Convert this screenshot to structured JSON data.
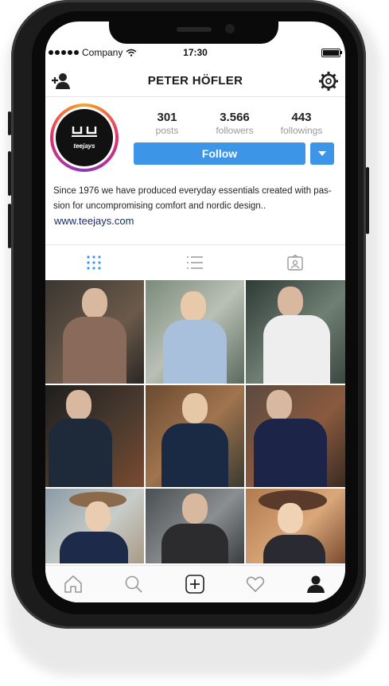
{
  "status_bar": {
    "carrier": "Company",
    "time": "17:30"
  },
  "profile": {
    "name": "PETER HÖFLER",
    "logo_text": "teejays",
    "stats": [
      {
        "value": "301",
        "label": "posts"
      },
      {
        "value": "3.566",
        "label": "followers"
      },
      {
        "value": "443",
        "label": "followings"
      }
    ],
    "follow_label": "Follow",
    "bio_line1": "Since 1976 we have produced everyday essentials created with pas-",
    "bio_line2": "sion for uncompromising comfort and nordic design..",
    "website": "www.teejays.com"
  },
  "icons": {
    "top_left": "add-person-icon",
    "top_right": "gear-icon",
    "tabs": [
      "grid-icon",
      "list-icon",
      "tagged-icon"
    ],
    "bottom_nav": [
      "home-icon",
      "search-icon",
      "add-post-icon",
      "heart-icon",
      "profile-icon"
    ]
  },
  "colors": {
    "accent": "#3d95e8",
    "link": "#1a2b6b",
    "active_tab": "#3d95e8"
  }
}
